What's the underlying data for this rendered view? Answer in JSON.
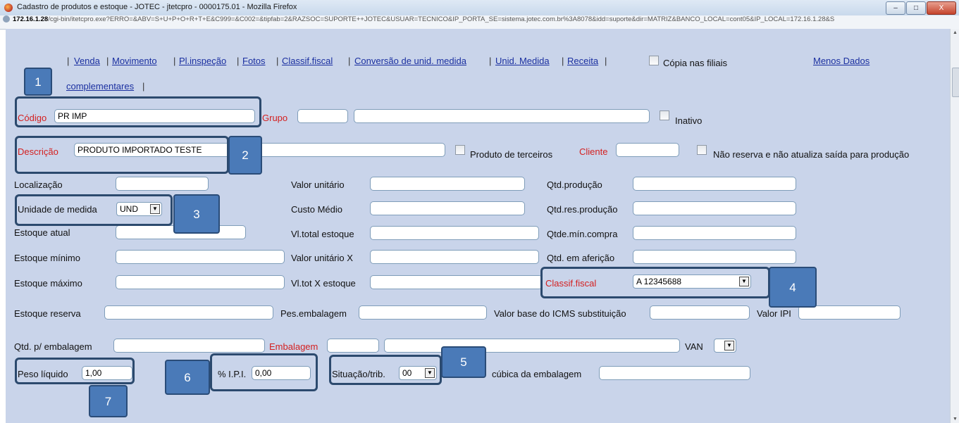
{
  "window": {
    "title": "Cadastro de produtos e estoque - JOTEC - jtetcpro - 0000175.01 - Mozilla Firefox",
    "minimize": "–",
    "maximize": "□",
    "close": "X"
  },
  "urlbar": {
    "host": "172.16.1.28",
    "path": "/cgi-bin/itetcpro.exe?ERRO=&ABV=S+U+P+O+R+T+E&C999=&C002=&tipfab=2&RAZSOC=SUPORTE++JOTEC&USUAR=TECNICO&IP_PORTA_SE=sistema.jotec.com.br%3A8078&idd=suporte&dir=MATRIZ&BANCO_LOCAL=cont05&IP_LOCAL=172.16.1.28&S"
  },
  "nav": {
    "links": [
      "Venda",
      "Movimento",
      "Pl.inspeção",
      "Fotos",
      "Classif.fiscal",
      "Conversão de unid. medida",
      "Unid. Medida",
      "Receita"
    ],
    "complementares": "complementares",
    "copia_filiais": "Cópia nas filiais",
    "menos_dados": "Menos Dados"
  },
  "form": {
    "codigo_label": "Código",
    "codigo_value": "PR IMP",
    "grupo_label": "Grupo",
    "inativo_label": "Inativo",
    "descricao_label": "Descrição",
    "descricao_value": "PRODUTO IMPORTADO TESTE",
    "produto_terceiros": "Produto de terceiros",
    "cliente_label": "Cliente",
    "nao_reserva": "Não reserva e não atualiza saída para produção",
    "localizacao": "Localização",
    "valor_unitario": "Valor unitário",
    "qtd_producao": "Qtd.produção",
    "unidade_medida": "Unidade de medida",
    "unidade_value": "UND",
    "custo_medio": "Custo Médio",
    "qtd_res_producao": "Qtd.res.produção",
    "estoque_atual": "Estoque atual",
    "vl_total_estoque": "Vl.total estoque",
    "qtde_min_compra": "Qtde.mín.compra",
    "estoque_minimo": "Estoque mínimo",
    "valor_unitario_x": "Valor unitário X",
    "qtd_afericao": "Qtd. em aferição",
    "estoque_maximo": "Estoque máximo",
    "vl_tot_x_estoque": "Vl.tot X estoque",
    "classif_fiscal_label": "Classif.fiscal",
    "classif_fiscal_value": "A  12345688",
    "estoque_reserva": "Estoque reserva",
    "pes_embalagem": "Pes.embalagem",
    "valor_base_icms": "Valor base do ICMS substituição",
    "valor_ipi": "Valor IPI",
    "qtd_embalagem": "Qtd. p/ embalagem",
    "embalagem_label": "Embalagem",
    "van_label": "VAN",
    "peso_liquido": "Peso líquido",
    "peso_liquido_value": "1,00",
    "ipi_label": "% I.P.I.",
    "ipi_value": "0,00",
    "situacao_trib": "Situação/trib.",
    "situacao_value": "00",
    "cubica_embalagem": "cúbica da embalagem"
  },
  "badges": [
    "1",
    "2",
    "3",
    "4",
    "5",
    "6",
    "7"
  ],
  "colors": {
    "background": "#c9d4ea",
    "required_label": "#d42020",
    "badge": "#4a7ab8",
    "link": "#1a2fa0"
  }
}
